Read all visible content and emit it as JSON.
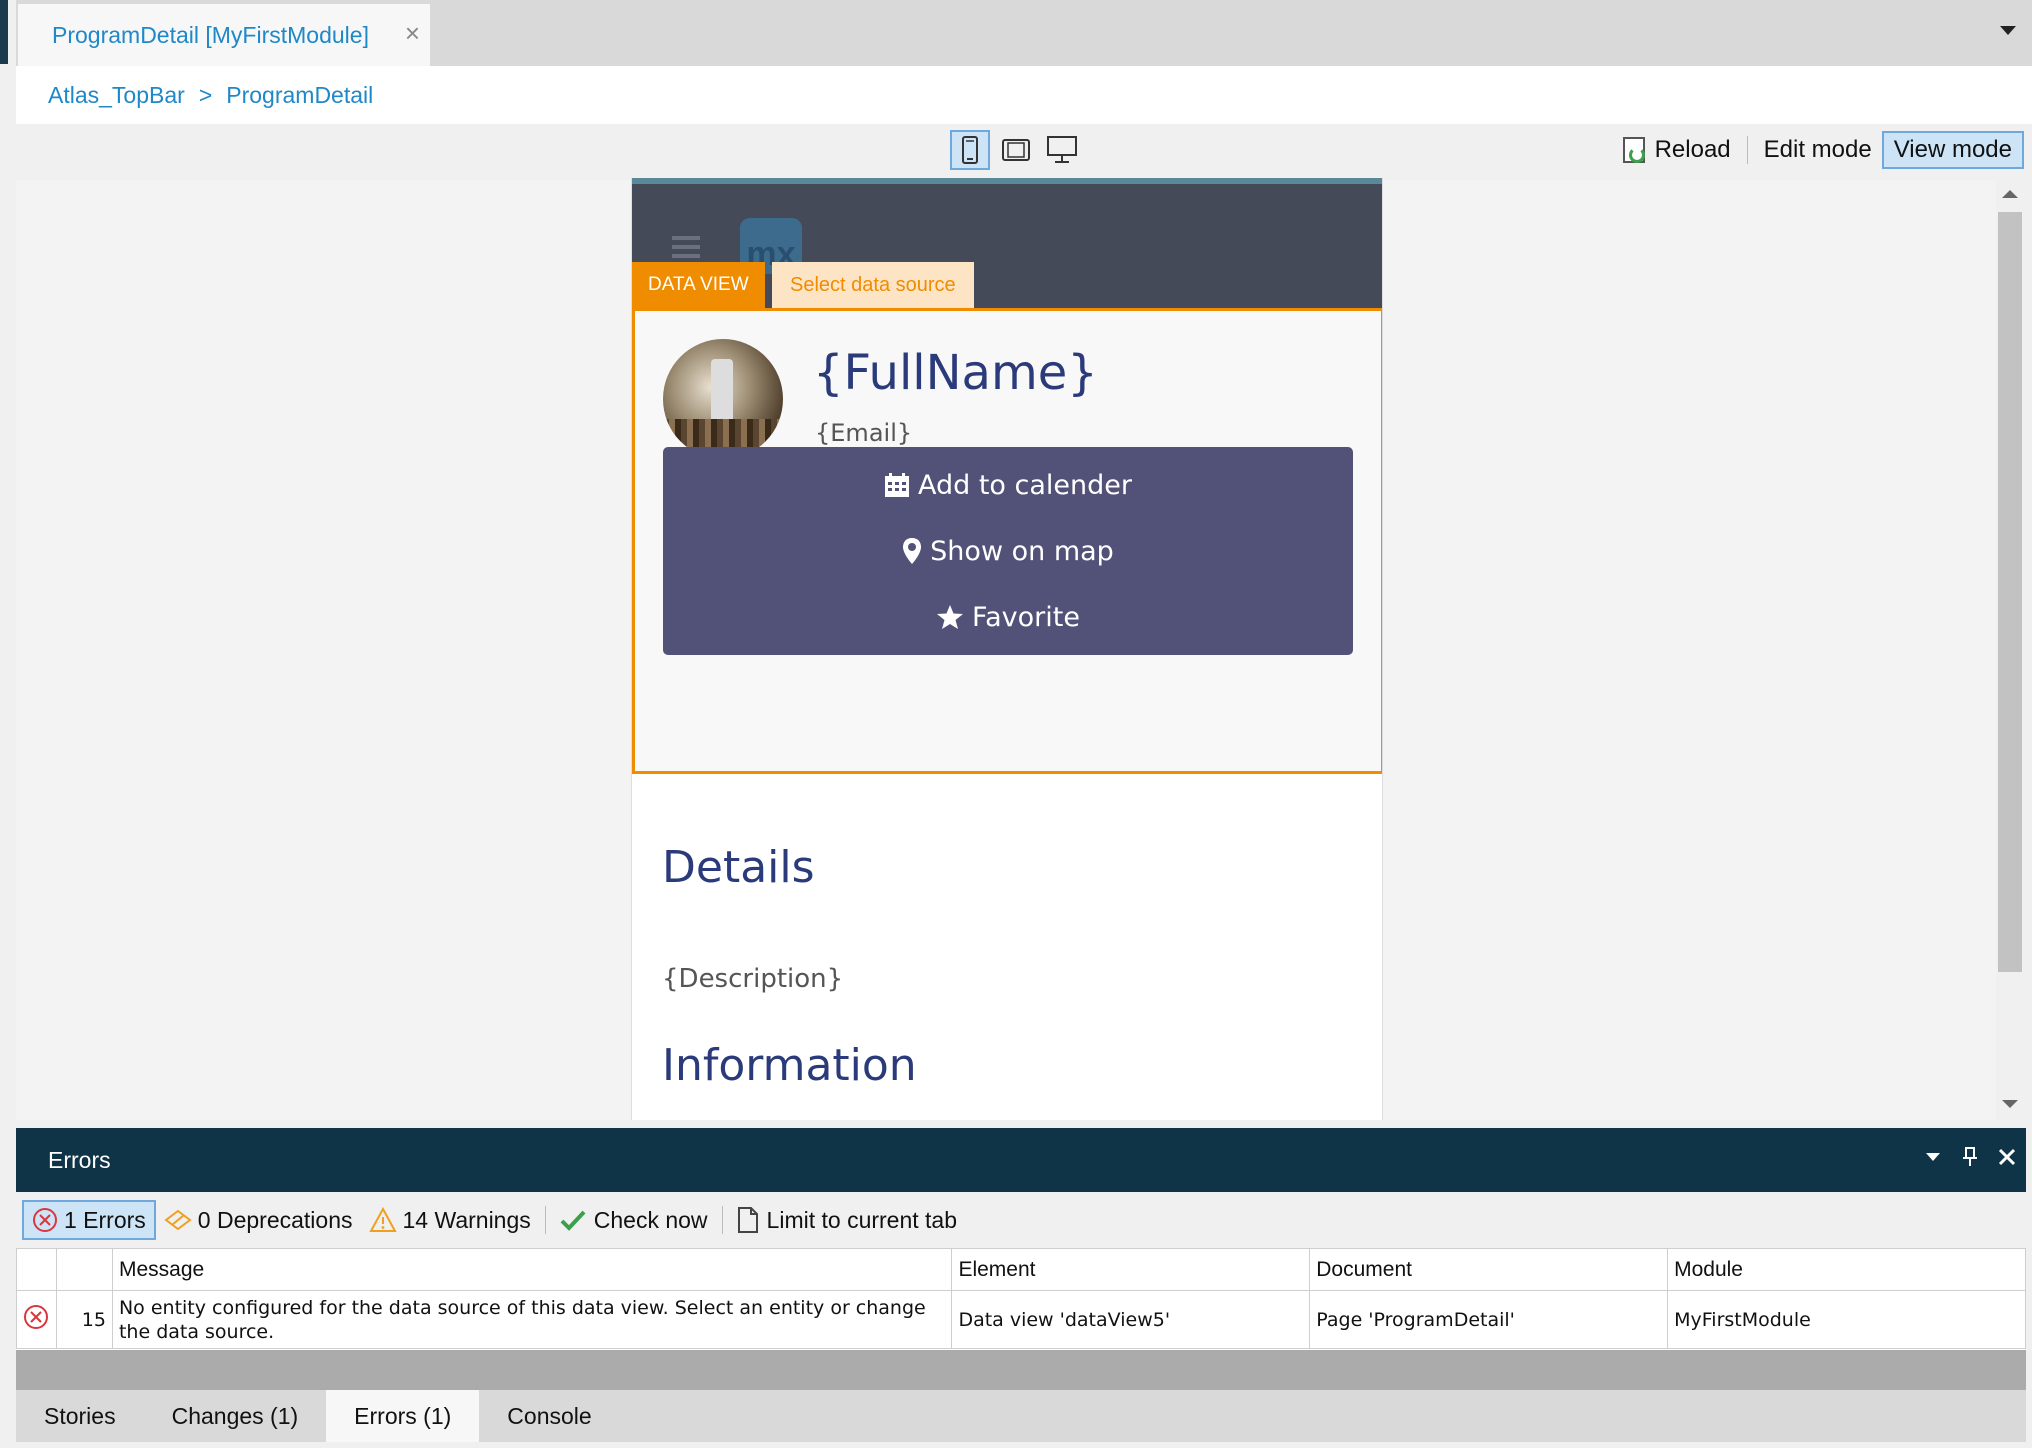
{
  "document_tab": {
    "label": "ProgramDetail [MyFirstModule]",
    "close": "×"
  },
  "breadcrumb": {
    "parent": "Atlas_TopBar",
    "separator": ">",
    "current": "ProgramDetail"
  },
  "toolbar": {
    "reload": "Reload",
    "edit_mode": "Edit mode",
    "view_mode": "View mode",
    "active_device": "phone"
  },
  "phone_page": {
    "data_view_label": "DATA VIEW",
    "data_view_source": "Select data source",
    "full_name": "{FullName}",
    "email": "{Email}",
    "buttons": [
      {
        "label": "Add to calender",
        "icon": "calendar-icon"
      },
      {
        "label": "Show on map",
        "icon": "map-marker-icon"
      },
      {
        "label": "Favorite",
        "icon": "star-icon"
      }
    ],
    "details_heading": "Details",
    "description": "{Description}",
    "information_heading": "Information",
    "logo_text": "mx"
  },
  "errors_pane": {
    "title": "Errors",
    "filters": {
      "errors": "1 Errors",
      "deprecations": "0 Deprecations",
      "warnings": "14 Warnings",
      "check_now": "Check now",
      "limit": "Limit to current tab"
    },
    "columns": [
      "Message",
      "Element",
      "Document",
      "Module"
    ],
    "rows": [
      {
        "code": "15",
        "message": "No entity configured for the data source of this data view. Select an entity or change the data source.",
        "element": "Data view 'dataView5'",
        "document": "Page 'ProgramDetail'",
        "module": "MyFirstModule"
      }
    ]
  },
  "bottom_tabs": [
    "Stories",
    "Changes (1)",
    "Errors (1)",
    "Console"
  ],
  "colors": {
    "accent": "#1e88c8",
    "dataview_orange": "#f08c00",
    "button_purple": "#525279",
    "heading_blue": "#2a3a7a",
    "pane_header": "#0f3447"
  }
}
